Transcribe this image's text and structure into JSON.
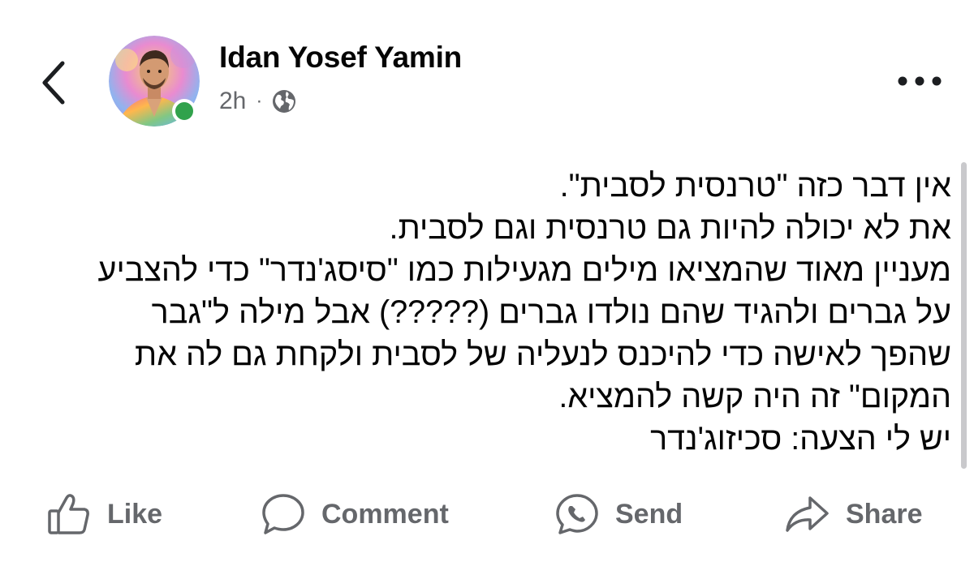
{
  "header": {
    "author_name": "Idan Yosef Yamin",
    "time": "2h",
    "separator": "·",
    "privacy_icon": "globe-icon",
    "back_icon": "chevron-left-icon",
    "more_icon": "more-horizontal-icon",
    "online_status_color": "#31a24c"
  },
  "post": {
    "lines": [
      "אין דבר כזה \"טרנסית לסבית\".",
      "את לא יכולה להיות גם טרנסית וגם לסבית.",
      "מעניין מאוד שהמציאו מילים מגעילות כמו \"סיסג'נדר\" כדי להצביע",
      "על גברים ולהגיד שהם נולדו גברים (?????) אבל מילה ל\"גבר",
      "שהפך לאישה כדי להיכנס לנעליה של לסבית ולקחת גם לה את",
      "המקום\" זה היה קשה להמציא.",
      "יש לי הצעה: סכיזוג'נדר"
    ]
  },
  "actions": {
    "like": {
      "label": "Like",
      "icon": "thumbs-up-icon"
    },
    "comment": {
      "label": "Comment",
      "icon": "comment-bubble-icon"
    },
    "send": {
      "label": "Send",
      "icon": "messenger-icon"
    },
    "share": {
      "label": "Share",
      "icon": "share-arrow-icon"
    }
  },
  "colors": {
    "text_primary": "#050505",
    "text_secondary": "#65676b",
    "background": "#ffffff"
  }
}
